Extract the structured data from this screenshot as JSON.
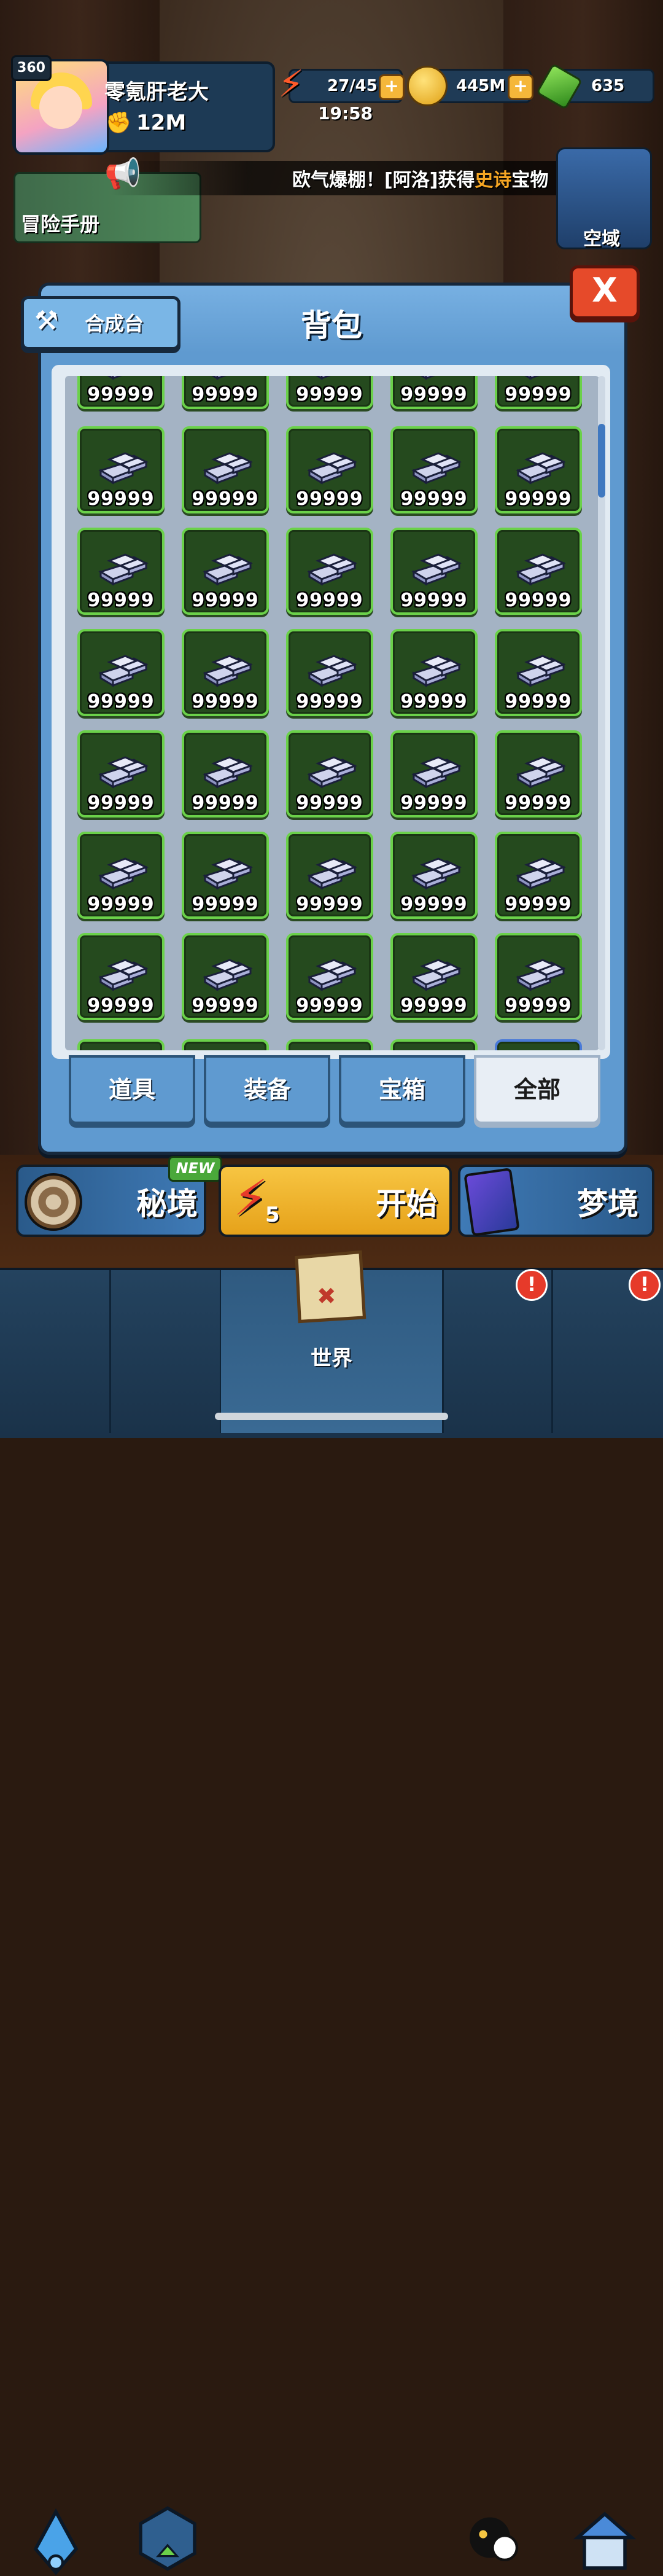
{
  "hud": {
    "level": "360",
    "player_name": "零氪肝老大",
    "power": "12M",
    "energy": "27/45",
    "energy_timer": "19:58",
    "gold": "445M",
    "gems": "635",
    "plus": "+"
  },
  "ticker": {
    "prefix": "欧气爆棚！[阿洛]获得",
    "highlight": "史诗",
    "suffix": "宝物"
  },
  "side": {
    "manual_label": "冒险手册",
    "airzone_label": "空域"
  },
  "modal": {
    "title": "背包",
    "close_label": "X",
    "craft_label": "合成台",
    "item_qty": "99999",
    "tabs": [
      "道具",
      "装备",
      "宝箱",
      "全部"
    ],
    "active_tab": "全部"
  },
  "actions": {
    "secret_label": "秘境",
    "new_badge": "NEW",
    "start_label": "开始",
    "start_cost": "5",
    "dream_label": "梦境"
  },
  "nav": {
    "world_label": "世界",
    "alert": "!"
  },
  "colors": {
    "item_border": "#6bd14a",
    "item_bg": "#254a1e",
    "panel": "#5f9ad0",
    "close": "#e64a2a",
    "start": "#f7c542",
    "ticker_highlight": "#f6a623"
  },
  "icons": {
    "item": "silver-ingot-icon",
    "energy": "lightning-icon",
    "gold": "gold-coin-icon",
    "gem": "green-gem-icon",
    "craft": "anvil-icon",
    "announce": "megaphone-icon"
  }
}
